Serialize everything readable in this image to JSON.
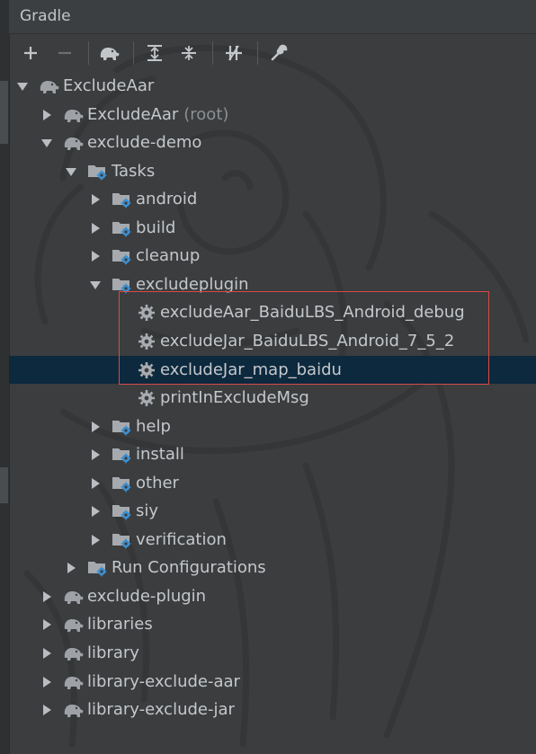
{
  "panel": {
    "title": "Gradle"
  },
  "toolbar": {
    "buttons": [
      {
        "name": "add",
        "icon": "plus-icon",
        "enabled": true
      },
      {
        "name": "remove",
        "icon": "minus-icon",
        "enabled": false
      },
      {
        "name": "run-gradle-task",
        "icon": "elephant-icon",
        "enabled": true
      },
      {
        "name": "expand-all",
        "icon": "expand-all-icon",
        "enabled": true
      },
      {
        "name": "collapse-all",
        "icon": "collapse-all-icon",
        "enabled": true
      },
      {
        "name": "toggle-offline",
        "icon": "offline-icon",
        "enabled": true
      },
      {
        "name": "gradle-settings",
        "icon": "wrench-icon",
        "enabled": true
      }
    ]
  },
  "tree": {
    "rows": [
      {
        "label": "ExcludeAar",
        "suffix": "",
        "indent": 0,
        "state": "expanded",
        "icon": "elephant-icon"
      },
      {
        "label": "ExcludeAar",
        "suffix": "(root)",
        "indent": 1,
        "state": "collapsed",
        "icon": "elephant-icon"
      },
      {
        "label": "exclude-demo",
        "suffix": "",
        "indent": 1,
        "state": "expanded",
        "icon": "elephant-icon"
      },
      {
        "label": "Tasks",
        "suffix": "",
        "indent": 2,
        "state": "expanded",
        "icon": "task-folder-icon"
      },
      {
        "label": "android",
        "suffix": "",
        "indent": 3,
        "state": "collapsed",
        "icon": "task-folder-icon"
      },
      {
        "label": "build",
        "suffix": "",
        "indent": 3,
        "state": "collapsed",
        "icon": "task-folder-icon"
      },
      {
        "label": "cleanup",
        "suffix": "",
        "indent": 3,
        "state": "collapsed",
        "icon": "task-folder-icon"
      },
      {
        "label": "excludeplugin",
        "suffix": "",
        "indent": 3,
        "state": "expanded",
        "icon": "task-folder-icon"
      },
      {
        "label": "excludeAar_BaiduLBS_Android_debug",
        "suffix": "",
        "indent": 4,
        "state": "leaf",
        "icon": "gear-icon"
      },
      {
        "label": "excludeJar_BaiduLBS_Android_7_5_2",
        "suffix": "",
        "indent": 4,
        "state": "leaf",
        "icon": "gear-icon"
      },
      {
        "label": "excludeJar_map_baidu",
        "suffix": "",
        "indent": 4,
        "state": "leaf",
        "icon": "gear-icon",
        "selected": true
      },
      {
        "label": "printInExcludeMsg",
        "suffix": "",
        "indent": 4,
        "state": "leaf",
        "icon": "gear-icon"
      },
      {
        "label": "help",
        "suffix": "",
        "indent": 3,
        "state": "collapsed",
        "icon": "task-folder-icon"
      },
      {
        "label": "install",
        "suffix": "",
        "indent": 3,
        "state": "collapsed",
        "icon": "task-folder-icon"
      },
      {
        "label": "other",
        "suffix": "",
        "indent": 3,
        "state": "collapsed",
        "icon": "task-folder-icon"
      },
      {
        "label": "siy",
        "suffix": "",
        "indent": 3,
        "state": "collapsed",
        "icon": "task-folder-icon"
      },
      {
        "label": "verification",
        "suffix": "",
        "indent": 3,
        "state": "collapsed",
        "icon": "task-folder-icon"
      },
      {
        "label": "Run Configurations",
        "suffix": "",
        "indent": 2,
        "state": "collapsed",
        "icon": "task-folder-icon"
      },
      {
        "label": "exclude-plugin",
        "suffix": "",
        "indent": 1,
        "state": "collapsed",
        "icon": "elephant-icon"
      },
      {
        "label": "libraries",
        "suffix": "",
        "indent": 1,
        "state": "collapsed",
        "icon": "elephant-icon"
      },
      {
        "label": "library",
        "suffix": "",
        "indent": 1,
        "state": "collapsed",
        "icon": "elephant-icon"
      },
      {
        "label": "library-exclude-aar",
        "suffix": "",
        "indent": 1,
        "state": "collapsed",
        "icon": "elephant-icon"
      },
      {
        "label": "library-exclude-jar",
        "suffix": "",
        "indent": 1,
        "state": "collapsed",
        "icon": "elephant-icon"
      }
    ]
  },
  "colors": {
    "background": "#3b3d3f",
    "selection": "#0d293e",
    "annotation_box": "#d94b46",
    "gear_blue": "#3e8fd0"
  }
}
